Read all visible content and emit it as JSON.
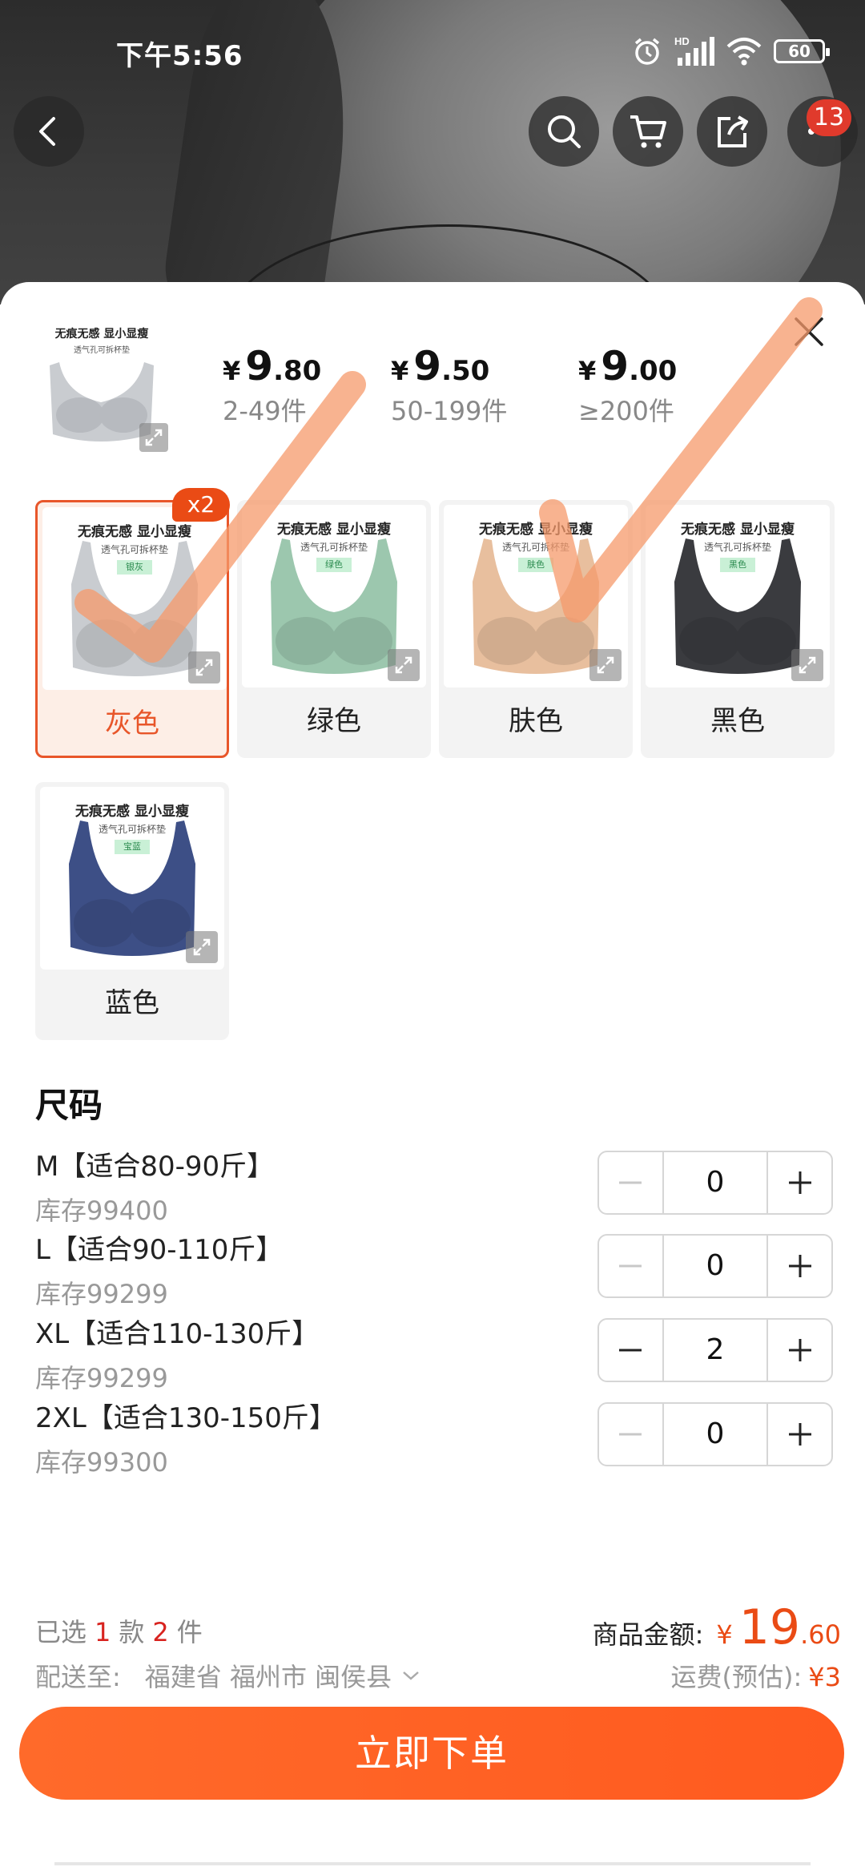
{
  "status_bar": {
    "time": "下午5:56",
    "battery": "60",
    "hd": "HD"
  },
  "nav": {
    "cart_badge": "13"
  },
  "price_tiers": [
    {
      "yen": "¥",
      "int": "9",
      "dec": ".80",
      "qty": "2-49件"
    },
    {
      "yen": "¥",
      "int": "9",
      "dec": ".50",
      "qty": "50-199件"
    },
    {
      "yen": "¥",
      "int": "9",
      "dec": ".00",
      "qty": "≥200件"
    }
  ],
  "product_image": {
    "title": "无痕无感 显小显瘦",
    "subtitle": "透气孔可拆杯垫"
  },
  "colors": [
    {
      "label": "灰色",
      "tag": "银灰",
      "badge": "x2",
      "color": "#c9ccd0"
    },
    {
      "label": "绿色",
      "tag": "绿色",
      "color": "#9cc7ae"
    },
    {
      "label": "肤色",
      "tag": "肤色",
      "color": "#e8bf9e"
    },
    {
      "label": "黑色",
      "tag": "黑色",
      "color": "#3a3b3f"
    },
    {
      "label": "蓝色",
      "tag": "宝蓝",
      "color": "#3d4f86"
    }
  ],
  "size_section": {
    "title": "尺码",
    "rows": [
      {
        "name": "M【适合80-90斤】",
        "stock": "库存99400",
        "qty": "0"
      },
      {
        "name": "L【适合90-110斤】",
        "stock": "库存99299",
        "qty": "0"
      },
      {
        "name": "XL【适合110-130斤】",
        "stock": "库存99299",
        "qty": "2"
      },
      {
        "name": "2XL【适合130-150斤】",
        "stock": "库存99300",
        "qty": "0"
      }
    ]
  },
  "summary": {
    "selected_prefix": "已选",
    "styles_count": "1",
    "styles_unit": "款",
    "items_count": "2",
    "items_unit": "件",
    "amount_label": "商品金额:",
    "amount_yen": "¥",
    "amount_int": "19",
    "amount_dec": ".60",
    "ship_label": "配送至:",
    "ship_address": "福建省 福州市 闽侯县",
    "freight_label": "运费(预估):",
    "freight_value": "¥3"
  },
  "order_button": "立即下单",
  "theme": {
    "accent": "#ff5a1f",
    "price_red": "#ea4b15"
  }
}
